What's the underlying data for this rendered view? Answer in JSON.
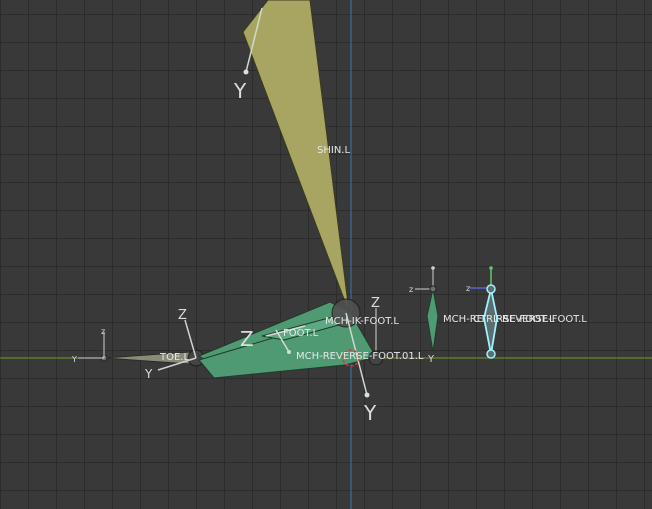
{
  "viewport": {
    "background": "#393939",
    "grid_color": "#2c2c2c",
    "x_axis_color": "#6f9a2c",
    "z_axis_color": "#3f72b0"
  },
  "colors": {
    "shin_fill": "#a7a561",
    "foot_fill": "#4f9a73",
    "toe_fill": "#8a8a7a",
    "selected_outline": "#9ff2ff",
    "label": "#e6e6e6",
    "axis_letter": "#dcdcdc"
  },
  "bones": {
    "shin": "SHIN.L",
    "toe": "TOE.L",
    "foot": "FOOT.L",
    "mch_ik_foot": "MCH-IK-FOOT.L",
    "mch_reverse_foot_01": "MCH-REVERSE-FOOT.01.L",
    "mch_reverse_foot": "MCH-REVERSE-FOOT.L",
    "ctrl_reverse_foot": "CTRL-REVERSE-FOOT.L"
  },
  "axis_letters": {
    "shin_y": "Y",
    "foot_z": "Z",
    "foot_y": "Y",
    "ik_z": "Z",
    "toe_z": "Z",
    "toe_y": "Y",
    "toe_base_z": "z",
    "toe_base_y": "Y",
    "reverse_z": "z",
    "reverse_y": "Y",
    "ctrl_z": "z"
  }
}
